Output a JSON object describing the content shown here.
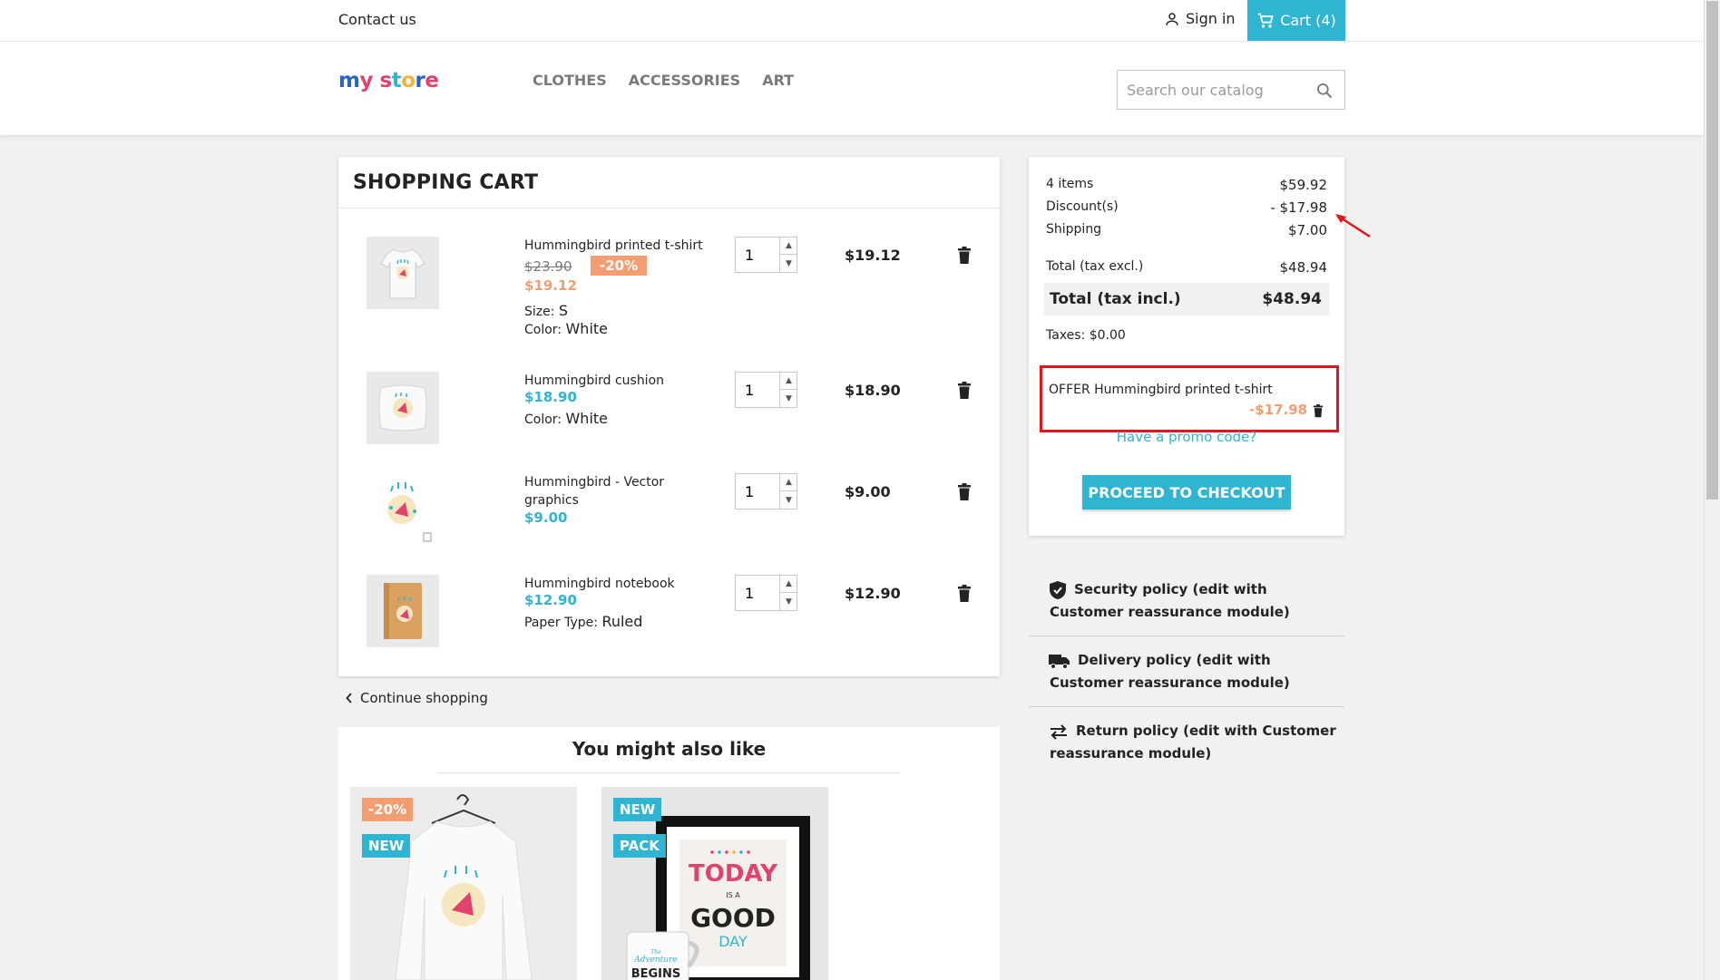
{
  "topbar": {
    "contact": "Contact us",
    "signin": "Sign in",
    "cart": "Cart (4)"
  },
  "header": {
    "logo": "my store",
    "menu": [
      "CLOTHES",
      "ACCESSORIES",
      "ART"
    ],
    "search_placeholder": "Search our catalog"
  },
  "cart": {
    "title": "SHOPPING CART",
    "items": [
      {
        "name": "Hummingbird printed t-shirt",
        "old_price": "$23.90",
        "discount": "-20%",
        "price": "$19.12",
        "attrs": [
          {
            "label": "Size:",
            "value": "S"
          },
          {
            "label": "Color:",
            "value": "White"
          }
        ],
        "qty": "1",
        "total": "$19.12"
      },
      {
        "name": "Hummingbird cushion",
        "price": "$18.90",
        "attrs": [
          {
            "label": "Color:",
            "value": "White"
          }
        ],
        "qty": "1",
        "total": "$18.90"
      },
      {
        "name": "Hummingbird - Vector graphics",
        "price": "$9.00",
        "attrs": [],
        "qty": "1",
        "total": "$9.00"
      },
      {
        "name": "Hummingbird notebook",
        "price": "$12.90",
        "attrs": [
          {
            "label": "Paper Type:",
            "value": "Ruled"
          }
        ],
        "qty": "1",
        "total": "$12.90"
      }
    ],
    "continue": "Continue shopping"
  },
  "summary": {
    "items_label": "4 items",
    "items_value": "$59.92",
    "discount_label": "Discount(s)",
    "discount_value": "- $17.98",
    "shipping_label": "Shipping",
    "shipping_value": "$7.00",
    "total_excl_label": "Total (tax excl.)",
    "total_excl_value": "$48.94",
    "total_incl_label": "Total (tax incl.)",
    "total_incl_value": "$48.94",
    "taxes": "Taxes: $0.00",
    "offer_label": "OFFER Hummingbird printed t-shirt",
    "offer_value": "-$17.98",
    "promo": "Have a promo code?",
    "checkout": "PROCEED TO CHECKOUT"
  },
  "reassurance": [
    {
      "icon": "shield-check-icon",
      "line1": "Security policy (edit with",
      "line2": "Customer reassurance module)"
    },
    {
      "icon": "truck-icon",
      "line1": "Delivery policy (edit with",
      "line2": "Customer reassurance module)"
    },
    {
      "icon": "swap-arrows-icon",
      "line1": "Return policy (edit with Customer",
      "line2": "reassurance module)"
    }
  ],
  "also_like": {
    "title": "You might also like",
    "products": [
      {
        "tags": [
          "-20%",
          "NEW"
        ]
      },
      {
        "tags": [
          "NEW",
          "PACK"
        ],
        "poster": [
          "TODAY",
          "IS A",
          "GOOD",
          "DAY"
        ],
        "mug": [
          "The",
          "Adventure",
          "BEGINS"
        ]
      }
    ]
  },
  "colors": {
    "accent": "#2fb5d2",
    "discount": "#f39d72",
    "annotation": "#e5151d"
  }
}
